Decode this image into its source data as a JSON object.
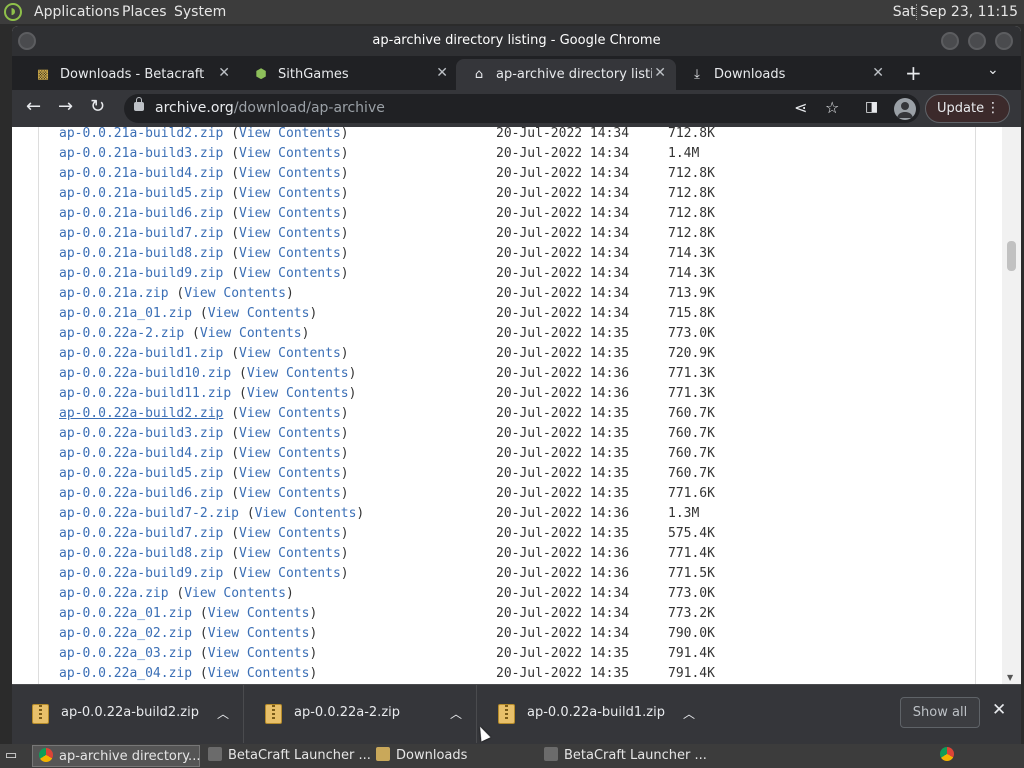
{
  "system_bar": {
    "menus": [
      "Applications",
      "Places",
      "System"
    ],
    "clock": "Sat Sep 23, 11:15"
  },
  "window": {
    "title": "ap-archive directory listing - Google Chrome"
  },
  "tabs": [
    {
      "label": "Downloads - Betacraft",
      "icon": "betacraft-icon",
      "active": false
    },
    {
      "label": "SithGames",
      "icon": "sithgames-icon",
      "active": false
    },
    {
      "label": "ap-archive directory listing",
      "icon": "archive-icon",
      "active": true
    },
    {
      "label": "Downloads",
      "icon": "download-icon",
      "active": false
    }
  ],
  "toolbar": {
    "url_host": "archive.org",
    "url_path": "/download/ap-archive",
    "update_label": "Update"
  },
  "listing": {
    "view_label": "View Contents",
    "rows": [
      {
        "name": "ap-0.0.21a-build2.zip",
        "date": "20-Jul-2022 14:34",
        "size": "712.8K"
      },
      {
        "name": "ap-0.0.21a-build3.zip",
        "date": "20-Jul-2022 14:34",
        "size": "1.4M"
      },
      {
        "name": "ap-0.0.21a-build4.zip",
        "date": "20-Jul-2022 14:34",
        "size": "712.8K"
      },
      {
        "name": "ap-0.0.21a-build5.zip",
        "date": "20-Jul-2022 14:34",
        "size": "712.8K"
      },
      {
        "name": "ap-0.0.21a-build6.zip",
        "date": "20-Jul-2022 14:34",
        "size": "712.8K"
      },
      {
        "name": "ap-0.0.21a-build7.zip",
        "date": "20-Jul-2022 14:34",
        "size": "712.8K"
      },
      {
        "name": "ap-0.0.21a-build8.zip",
        "date": "20-Jul-2022 14:34",
        "size": "714.3K"
      },
      {
        "name": "ap-0.0.21a-build9.zip",
        "date": "20-Jul-2022 14:34",
        "size": "714.3K"
      },
      {
        "name": "ap-0.0.21a.zip",
        "date": "20-Jul-2022 14:34",
        "size": "713.9K"
      },
      {
        "name": "ap-0.0.21a_01.zip",
        "date": "20-Jul-2022 14:34",
        "size": "715.8K"
      },
      {
        "name": "ap-0.0.22a-2.zip",
        "date": "20-Jul-2022 14:35",
        "size": "773.0K"
      },
      {
        "name": "ap-0.0.22a-build1.zip",
        "date": "20-Jul-2022 14:35",
        "size": "720.9K"
      },
      {
        "name": "ap-0.0.22a-build10.zip",
        "date": "20-Jul-2022 14:36",
        "size": "771.3K"
      },
      {
        "name": "ap-0.0.22a-build11.zip",
        "date": "20-Jul-2022 14:36",
        "size": "771.3K"
      },
      {
        "name": "ap-0.0.22a-build2.zip",
        "date": "20-Jul-2022 14:35",
        "size": "760.7K"
      },
      {
        "name": "ap-0.0.22a-build3.zip",
        "date": "20-Jul-2022 14:35",
        "size": "760.7K"
      },
      {
        "name": "ap-0.0.22a-build4.zip",
        "date": "20-Jul-2022 14:35",
        "size": "760.7K"
      },
      {
        "name": "ap-0.0.22a-build5.zip",
        "date": "20-Jul-2022 14:35",
        "size": "760.7K"
      },
      {
        "name": "ap-0.0.22a-build6.zip",
        "date": "20-Jul-2022 14:35",
        "size": "771.6K"
      },
      {
        "name": "ap-0.0.22a-build7-2.zip",
        "date": "20-Jul-2022 14:36",
        "size": "1.3M"
      },
      {
        "name": "ap-0.0.22a-build7.zip",
        "date": "20-Jul-2022 14:35",
        "size": "575.4K"
      },
      {
        "name": "ap-0.0.22a-build8.zip",
        "date": "20-Jul-2022 14:36",
        "size": "771.4K"
      },
      {
        "name": "ap-0.0.22a-build9.zip",
        "date": "20-Jul-2022 14:36",
        "size": "771.5K"
      },
      {
        "name": "ap-0.0.22a.zip",
        "date": "20-Jul-2022 14:34",
        "size": "773.0K"
      },
      {
        "name": "ap-0.0.22a_01.zip",
        "date": "20-Jul-2022 14:34",
        "size": "773.2K"
      },
      {
        "name": "ap-0.0.22a_02.zip",
        "date": "20-Jul-2022 14:34",
        "size": "790.0K"
      },
      {
        "name": "ap-0.0.22a_03.zip",
        "date": "20-Jul-2022 14:35",
        "size": "791.4K"
      },
      {
        "name": "ap-0.0.22a_04.zip",
        "date": "20-Jul-2022 14:35",
        "size": "791.4K"
      }
    ]
  },
  "downloads": {
    "items": [
      "ap-0.0.22a-build2.zip",
      "ap-0.0.22a-2.zip",
      "ap-0.0.22a-build1.zip"
    ],
    "show_all_label": "Show all"
  },
  "taskbar": {
    "tasks": [
      {
        "label": "ap-archive directory...",
        "active": true
      },
      {
        "label": "BetaCraft Launcher ...",
        "active": false
      },
      {
        "label": "Downloads",
        "active": false
      },
      {
        "label": "BetaCraft Launcher ...",
        "active": false
      }
    ]
  }
}
